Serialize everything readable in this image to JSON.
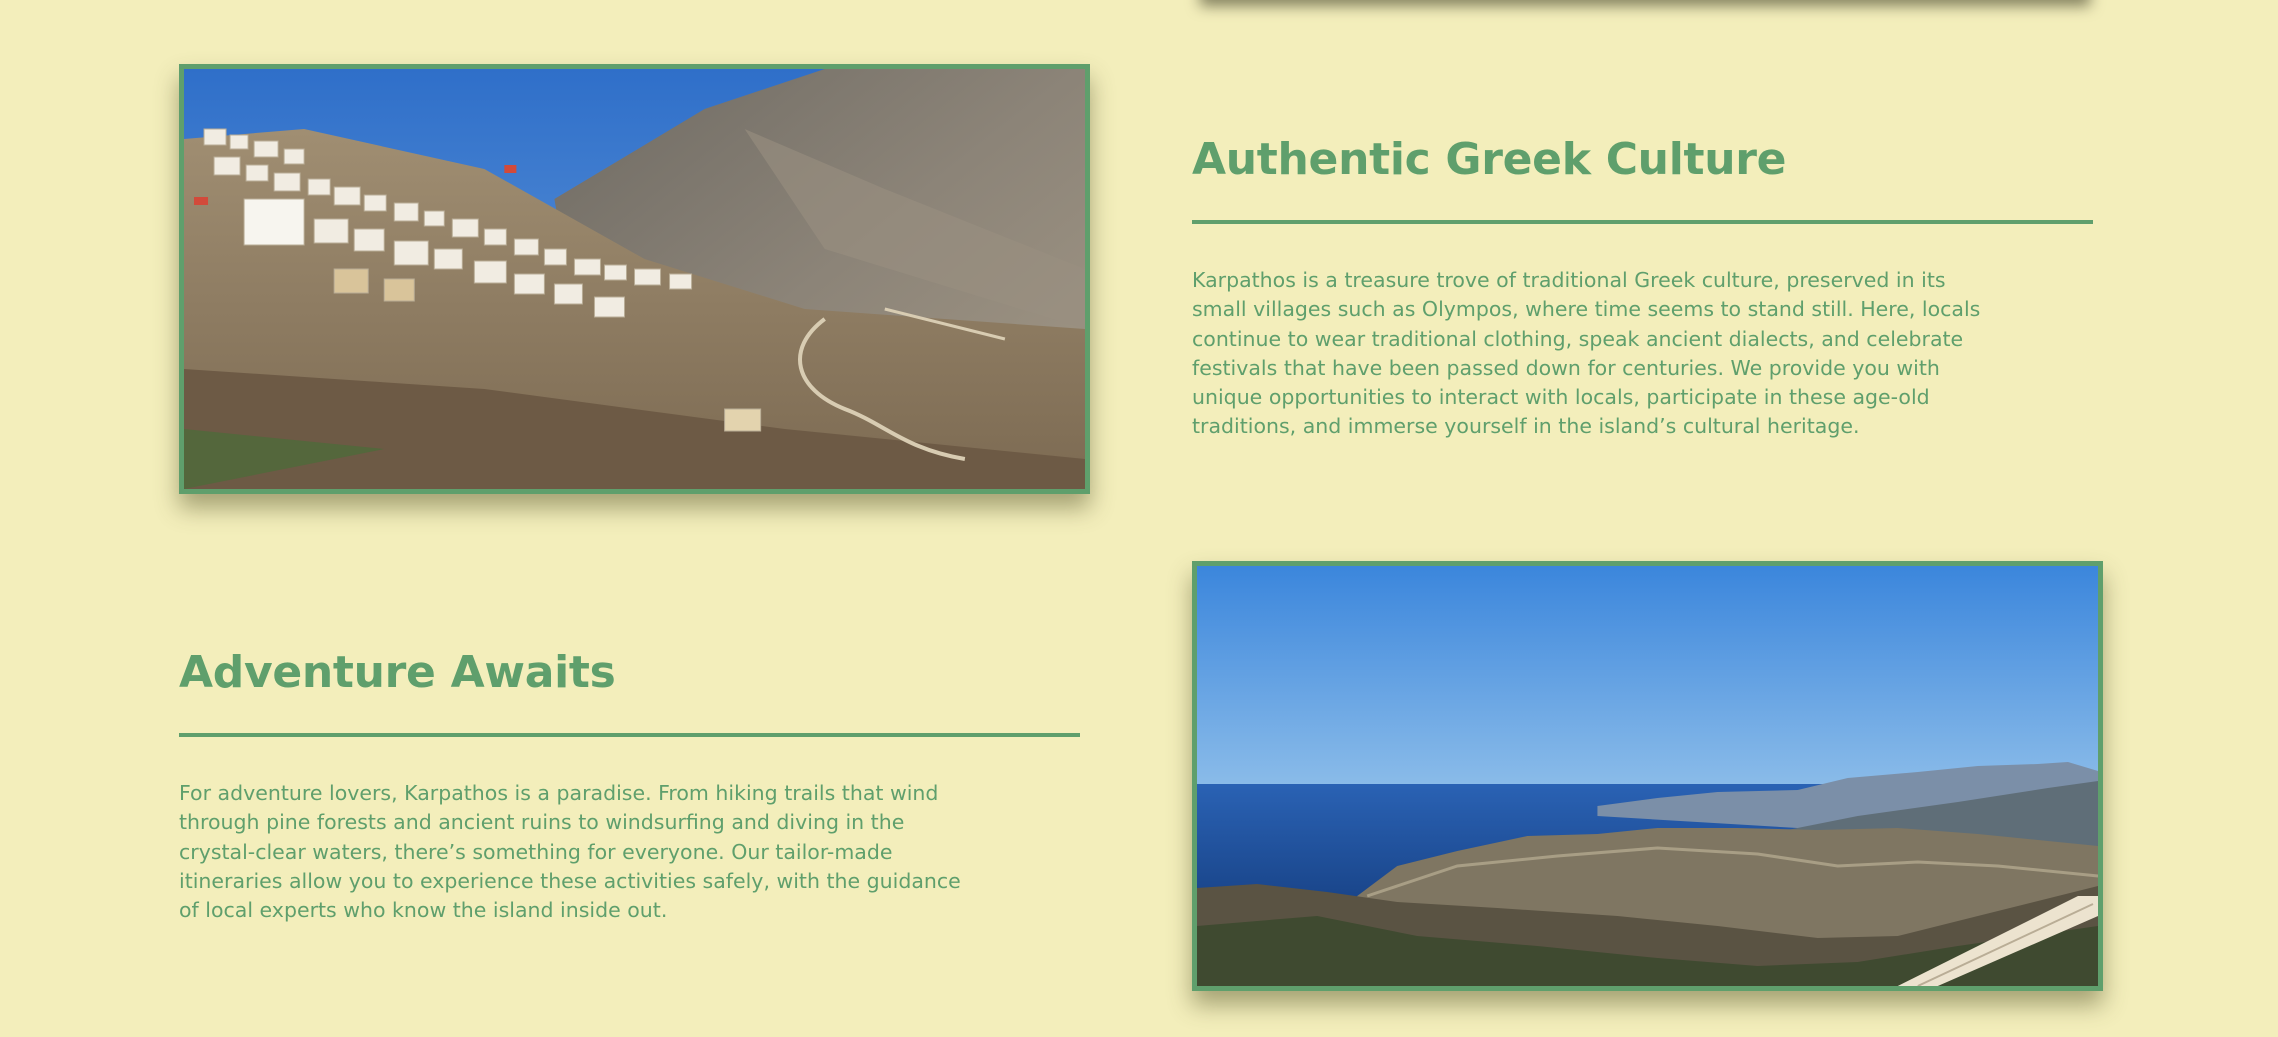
{
  "sections": [
    {
      "title": "Authentic Greek Culture",
      "body": "Karpathos is a treasure trove of traditional Greek culture, preserved in its small villages such as Olympos, where time seems to stand still. Here, locals continue to wear traditional clothing, speak ancient dialects, and celebrate festivals that have been passed down for centuries. We provide you with unique opportunities to interact with locals, participate in these age-old traditions, and immerse yourself in the island’s cultural heritage."
    },
    {
      "title": "Adventure Awaits",
      "body": "For adventure lovers, Karpathos is a paradise. From hiking trails that wind through pine forests and ancient ruins to windsurfing and diving in the crystal-clear waters, there’s something for everyone. Our tailor-made itineraries allow you to experience these activities safely, with the guidance of local experts who know the island inside out."
    }
  ],
  "colors": {
    "background": "#f3eebb",
    "accent": "#5f9f6c"
  }
}
